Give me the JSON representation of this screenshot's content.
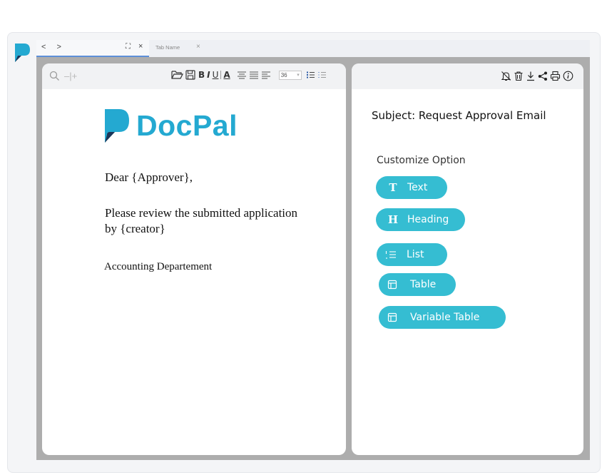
{
  "tabs": {
    "nav": "< >",
    "expand_glyph": "⛶",
    "close_glyph": "×",
    "second_tab_name": "Tab Name"
  },
  "toolbar": {
    "zoom_glyph": "–|+",
    "bold": "B",
    "italic": "I",
    "underline": "U",
    "font_color": "A",
    "font_size": "36",
    "font_size_arrow": "▾"
  },
  "document": {
    "logo_text": "DocPal",
    "greeting": "Dear {Approver},",
    "body_line1": "Please review the submitted application",
    "body_line2": "by {creator}",
    "signature": "Accounting Departement"
  },
  "email": {
    "subject": "Subject: Request Approval Email",
    "customize_title": "Customize Option",
    "options": [
      {
        "label": "Text",
        "icon_glyph": "T",
        "icon": "text-icon"
      },
      {
        "label": "Heading",
        "icon_glyph": "H",
        "icon": "heading-icon"
      },
      {
        "label": "List",
        "icon": "list-icon"
      },
      {
        "label": "Table",
        "icon": "table-icon"
      },
      {
        "label": "Variable Table",
        "icon": "table-icon"
      }
    ]
  },
  "colors": {
    "brand": "#24a9d1",
    "brand_dark": "#1d3557",
    "button": "#35bdd2",
    "workspace": "#adadad"
  }
}
